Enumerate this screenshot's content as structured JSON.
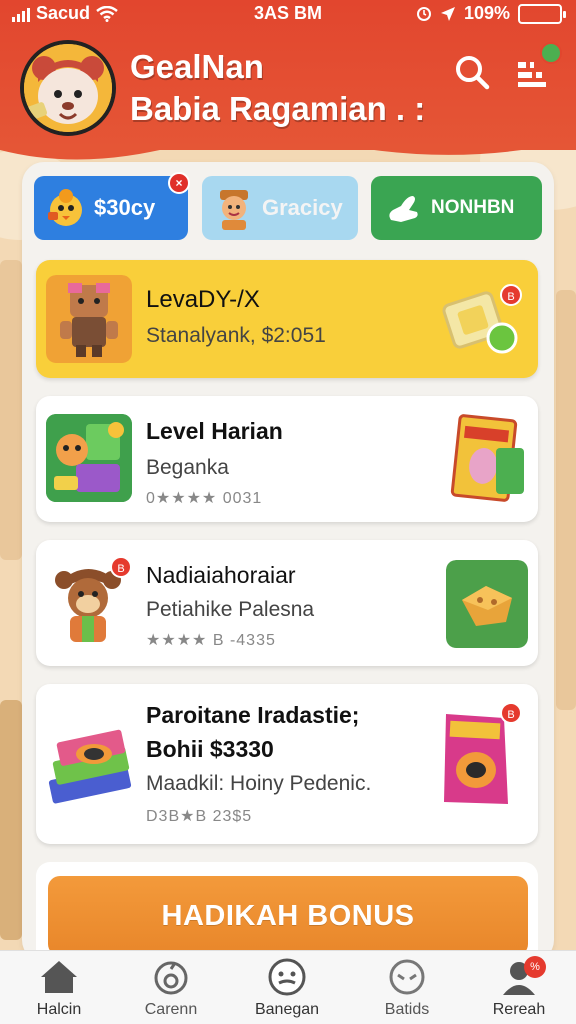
{
  "status_bar": {
    "carrier": "Sacud",
    "time": "3AS BM",
    "battery": "109%"
  },
  "header": {
    "title": "GealNan",
    "subtitle": "Babia Ragamian . :",
    "notification_count": ""
  },
  "chips": [
    {
      "label": "$30cy",
      "icon": "chick-icon",
      "badge": "×"
    },
    {
      "label": "Gracicy",
      "icon": "person-icon"
    },
    {
      "label": "NONHBN",
      "icon": "hand-icon"
    }
  ],
  "cards": [
    {
      "title": "LevaDY-/X",
      "sub": "Stanalyank, $2:051",
      "badge": "B"
    },
    {
      "title": "Level Harian",
      "sub": "Beganka",
      "meta": "0★★★★ 0031"
    },
    {
      "title": "Nadiaiahoraiar",
      "sub": "Petiahike Palesna",
      "meta": "★★★★ B -4335",
      "badge": "B"
    },
    {
      "title": "Paroitane Iradastie;",
      "title2": "Bohii $3330",
      "sub": "Maadkil: Hoiny Pedenic.",
      "meta": "D3B★B 23$5",
      "badge": "B"
    }
  ],
  "bonus_button": "HADIKAH BONUS",
  "bottom_nav": [
    {
      "label": "Halcin",
      "icon": "home-icon"
    },
    {
      "label": "Carenn",
      "icon": "apple-icon"
    },
    {
      "label": "Banegan",
      "icon": "face-icon"
    },
    {
      "label": "Batids",
      "icon": "mask-icon"
    },
    {
      "label": "Rereah",
      "icon": "user-icon",
      "badge": "%"
    }
  ],
  "colors": {
    "header_red": "#e2462e",
    "accent_yellow": "#f9cf3a",
    "bonus_orange": "#f39a3b",
    "chip_blue": "#2e7fe0",
    "chip_green": "#3aa552"
  }
}
